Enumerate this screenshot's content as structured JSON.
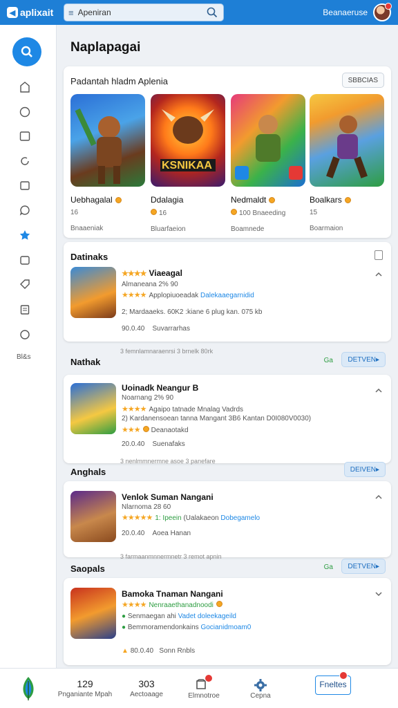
{
  "topbar": {
    "logo": "aplixait",
    "search_value": "Apeniran",
    "username": "Beanaeruse"
  },
  "sidebar": {
    "bottom_label": "Bl&s"
  },
  "page": {
    "title": "Naplapagai"
  },
  "featured": {
    "title": "Padantah hladm Aplenia",
    "see_all": "SBBCIAS",
    "items": [
      {
        "name": "Uebhagalal",
        "rating": "16",
        "sub": "Bnaaeniak"
      },
      {
        "name": "Ddalagia",
        "rating": "16",
        "sub": "Bluarfaeion"
      },
      {
        "name": "Nedmaldt",
        "rating": "100 Bnaeeding",
        "sub": "Boamnede"
      },
      {
        "name": "Boalkars",
        "rating": "15",
        "sub": "Boarmaion"
      }
    ]
  },
  "sections": [
    {
      "header": "Datinaks",
      "app_name": "Viaeagal",
      "line1": "Almaneana 2% 90",
      "line2_pre": "Applopiuoeadak",
      "line2_link": "Dalekaaegarnidid",
      "line3": "2; Mardaaeks. 60K2 :kiane 6 plug kan. 075 kb",
      "line4": "90.0.40",
      "line4b": "Suvarrarhas",
      "note": "",
      "open": "",
      "go": ""
    },
    {
      "header": "Nathak",
      "app_name": "Uoinadk Neangur B",
      "line1": "Noarnang 2% 90",
      "line2_pre": "Agaipo tatnade Mnalag Vadrds",
      "line2_link": "",
      "line3": "2) Kardanensoean tanna Mangant 3B6 Kantan D0I080V0030)",
      "line4": "Deanaotakd",
      "line4b": "",
      "line5": "20.0.40",
      "line5b": "Suenafaks",
      "note": "3 femnlamnaraenrsi 3 brnelk 80rk",
      "open": "DETVEN▸",
      "go": "Ga"
    },
    {
      "header": "Anghals",
      "app_name": "Venlok Suman Nangani",
      "line1": "Nlarnoma 28 60",
      "line2_pre": "1: Ipeein",
      "line2_link": "Dobegamelo",
      "line2_mid": "(Ualakaeon",
      "line4": "20.0.40",
      "line4b": "Aoea Hanan",
      "note": "3 nenlmmnermne asoe 3 panefare",
      "open": "DEIVEN▸",
      "go": ""
    },
    {
      "header": "Saopals",
      "app_name": "Bamoka Tnaman Nangani",
      "line2_pre": "Nenraaethanadnoodi",
      "line3_pre": "Senmaegan ahi",
      "line3_link": "Vadet doleekageild",
      "line3b": "Bemmoramendonkains",
      "line3b_link": "Gocianidmoam0",
      "line4": "80.0.40",
      "line4b": "Sonn Rnbls",
      "note": "3 farmaanmnnermnetr 3 remot apnin",
      "open": "DETVEN▸",
      "go": "Ga"
    }
  ],
  "bottombar": {
    "items": [
      {
        "num": "129",
        "sub": "Pnganiante Mpah"
      },
      {
        "num": "303",
        "sub": "Aectoaage"
      },
      {
        "num": "",
        "sub": "Elmnotroe"
      },
      {
        "num": "",
        "sub": "Cepna"
      },
      {
        "num": "Fneltes",
        "sub": ""
      }
    ]
  },
  "colors": {
    "topbar": "#1e7fd6",
    "accent": "#1e88e5",
    "star": "#f5a623",
    "badge": "#e53935"
  }
}
